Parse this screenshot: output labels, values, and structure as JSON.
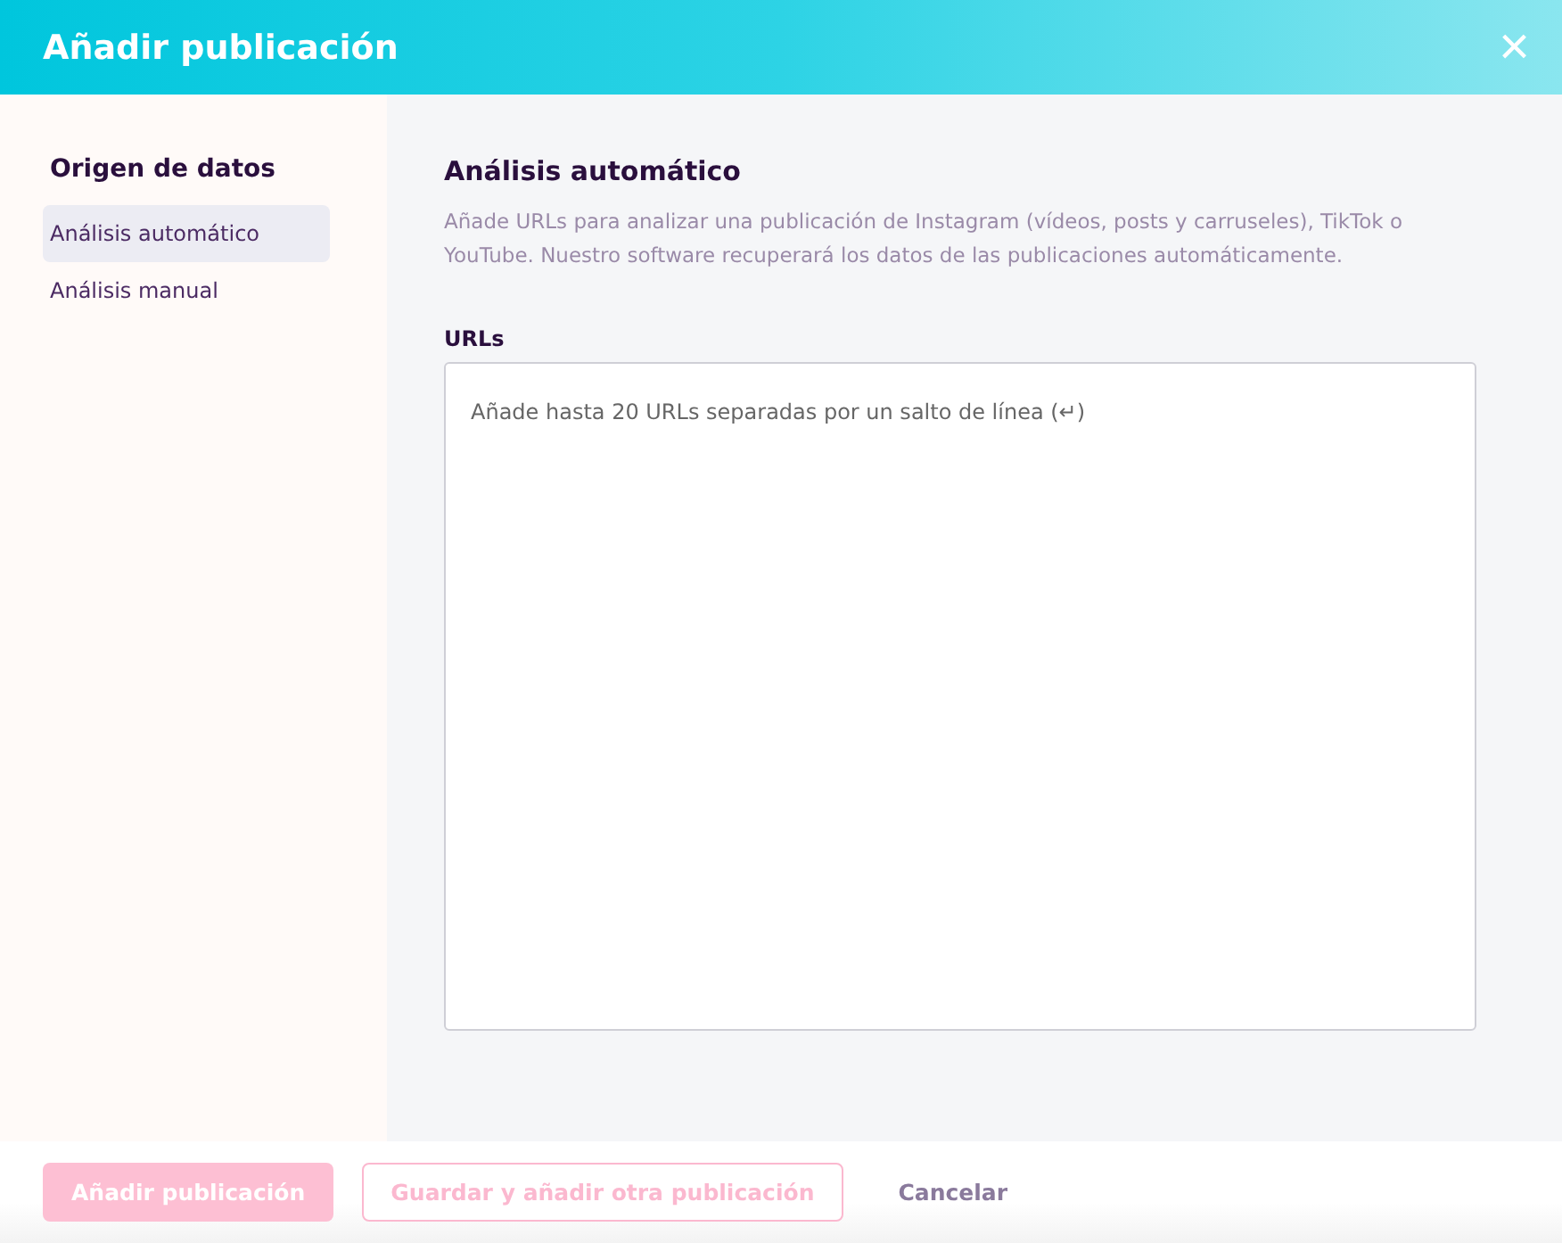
{
  "dialog": {
    "title": "Añadir publicación",
    "close_icon": "×"
  },
  "sidebar": {
    "title": "Origen de datos",
    "items": [
      {
        "label": "Análisis automático",
        "selected": true
      },
      {
        "label": "Análisis manual",
        "selected": false
      }
    ]
  },
  "content": {
    "title": "Análisis automático",
    "description": "Añade URLs para analizar una publicación de Instagram (vídeos, posts y carruseles), TikTok o YouTube. Nuestro software recuperará los datos de las publicaciones automáticamente.",
    "urls": {
      "label": "URLs",
      "placeholder": "Añade hasta 20 URLs separadas por un salto de línea (↵)"
    }
  },
  "footer": {
    "buttons": [
      {
        "label": "Añadir publicación",
        "kind": "primary",
        "disabled": true
      },
      {
        "label": "Guardar y añadir otra publicación",
        "kind": "outline",
        "disabled": true
      },
      {
        "label": "Cancelar",
        "kind": "text",
        "disabled": false
      }
    ]
  }
}
